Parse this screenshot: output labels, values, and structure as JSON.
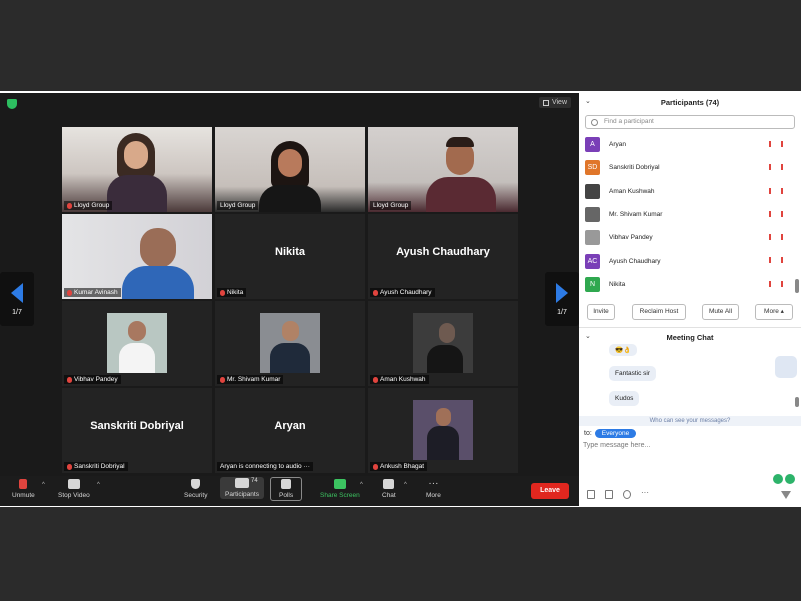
{
  "meeting": {
    "view_label": "View",
    "page_indicator": "1/7",
    "tiles": [
      {
        "label": "Lloyd Group",
        "type": "video",
        "bg": "#cfc9c4"
      },
      {
        "label": "Lloyd Group",
        "type": "video",
        "bg": "#c7c1bd",
        "active": true
      },
      {
        "label": "Lloyd Group",
        "type": "video",
        "bg": "#c8c3c0"
      },
      {
        "label": "Kumar Avinash",
        "type": "video",
        "bg": "#d7d6d8"
      },
      {
        "label": "Nikita",
        "type": "name",
        "big": "Nikita"
      },
      {
        "label": "Ayush Chaudhary",
        "type": "name",
        "big": "Ayush Chaudhary"
      },
      {
        "label": "Vibhav Pandey",
        "type": "photo",
        "bg": "#b9c7c2"
      },
      {
        "label": "Mr. Shivam Kumar",
        "type": "photo",
        "bg": "#8a8d92"
      },
      {
        "label": "Aman Kushwah",
        "type": "photo",
        "bg": "#3c3c3c"
      },
      {
        "label": "Sanskriti Dobriyal",
        "type": "name",
        "big": "Sanskriti Dobriyal"
      },
      {
        "label": "Aryan is connecting to audio ···",
        "type": "name",
        "big": "Aryan"
      },
      {
        "label": "Ankush Bhagat",
        "type": "photo",
        "bg": "#5a4f6a"
      }
    ]
  },
  "toolbar": {
    "unmute": "Unmute",
    "stop_video": "Stop Video",
    "security": "Security",
    "participants": "Participants",
    "participants_count": "74",
    "polls": "Polls",
    "share_screen": "Share Screen",
    "chat": "Chat",
    "more": "More",
    "leave": "Leave"
  },
  "participants_panel": {
    "title": "Participants (74)",
    "search_placeholder": "Find a participant",
    "people": [
      {
        "name": "Aryan",
        "initials": "A",
        "color": "#7a3fb7"
      },
      {
        "name": "Sanskriti Dobriyal",
        "initials": "SD",
        "color": "#e0762a"
      },
      {
        "name": "Aman Kushwah",
        "initials": "",
        "color": "#444444"
      },
      {
        "name": "Mr. Shivam Kumar",
        "initials": "",
        "color": "#666666"
      },
      {
        "name": "Vibhav Pandey",
        "initials": "",
        "color": "#999999"
      },
      {
        "name": "Ayush Chaudhary",
        "initials": "AC",
        "color": "#7a3fb7"
      },
      {
        "name": "Nikita",
        "initials": "N",
        "color": "#2fa84f"
      }
    ],
    "invite": "Invite",
    "reclaim_host": "Reclaim Host",
    "mute_all": "Mute All",
    "more": "More ▴"
  },
  "chat": {
    "title": "Meeting Chat",
    "messages": [
      "😎👌",
      "Fantastic sir",
      "Kudos"
    ],
    "who_can_see": "Who can see your messages?",
    "to_label": "to:",
    "recipient": "Everyone",
    "placeholder": "Type message here..."
  }
}
